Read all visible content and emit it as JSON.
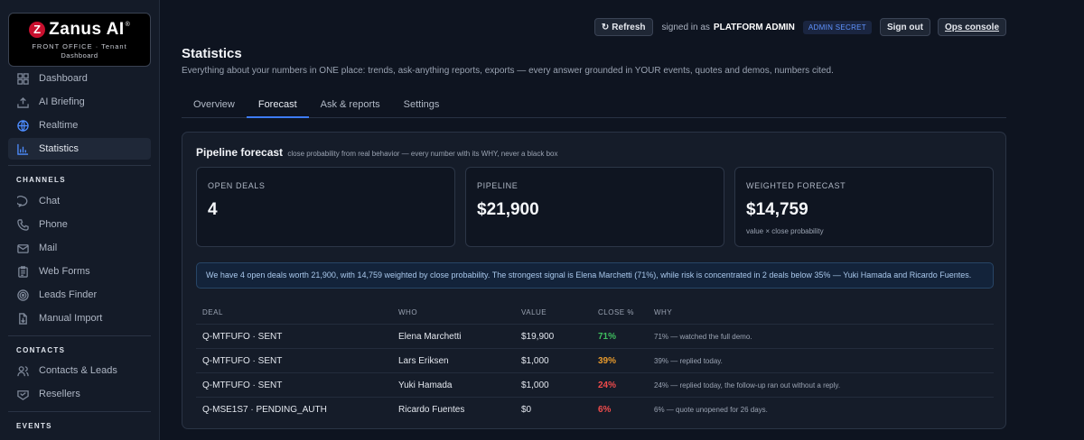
{
  "brand": {
    "logo_letter": "Z",
    "name": "Zanus AI",
    "reg_mark": "®",
    "subtitle": "FRONT OFFICE · Tenant",
    "subtitle2": "Dashboard"
  },
  "sidebar": {
    "main_items": [
      {
        "label": "Dashboard",
        "icon": "grid-icon"
      },
      {
        "label": "AI Briefing",
        "icon": "upload-tray-icon"
      },
      {
        "label": "Realtime",
        "icon": "globe-icon"
      },
      {
        "label": "Statistics",
        "icon": "bar-chart-icon",
        "active": true
      }
    ],
    "channels_label": "CHANNELS",
    "channel_items": [
      {
        "label": "Chat",
        "icon": "chat-bubble-icon"
      },
      {
        "label": "Phone",
        "icon": "phone-icon"
      },
      {
        "label": "Mail",
        "icon": "mail-icon"
      },
      {
        "label": "Web Forms",
        "icon": "clipboard-icon"
      },
      {
        "label": "Leads Finder",
        "icon": "target-icon"
      },
      {
        "label": "Manual Import",
        "icon": "file-import-icon"
      }
    ],
    "contacts_label": "CONTACTS",
    "contact_items": [
      {
        "label": "Contacts & Leads",
        "icon": "users-icon"
      },
      {
        "label": "Resellers",
        "icon": "handshake-icon"
      }
    ],
    "events_label": "EVENTS"
  },
  "topbar": {
    "refresh_icon": "↻",
    "refresh_label": "Refresh",
    "signed_in_text": "signed in as",
    "role": "PLATFORM ADMIN",
    "badge": "ADMIN SECRET",
    "signout_label": "Sign out",
    "ops_label": "Ops console"
  },
  "page": {
    "title": "Statistics",
    "description": "Everything about your numbers in ONE place: trends, ask-anything reports, exports — every answer grounded in YOUR events, quotes and demos, numbers cited."
  },
  "tabs": [
    {
      "label": "Overview"
    },
    {
      "label": "Forecast",
      "active": true
    },
    {
      "label": "Ask & reports"
    },
    {
      "label": "Settings"
    }
  ],
  "forecast": {
    "title": "Pipeline forecast",
    "subtitle": "close probability from real behavior — every number with its WHY, never a black box",
    "kpis": [
      {
        "label": "OPEN DEALS",
        "value": "4",
        "note": ""
      },
      {
        "label": "PIPELINE",
        "value": "$21,900",
        "note": ""
      },
      {
        "label": "WEIGHTED FORECAST",
        "value": "$14,759",
        "note": "value × close probability"
      }
    ],
    "insight": "We have 4 open deals worth 21,900, with 14,759 weighted by close probability. The strongest signal is Elena Marchetti (71%), while risk is concentrated in 2 deals below 35% — Yuki Hamada and Ricardo Fuentes.",
    "table": {
      "headers": [
        "DEAL",
        "WHO",
        "VALUE",
        "CLOSE %",
        "WHY"
      ],
      "rows": [
        {
          "deal": "Q-MTFUFO · SENT",
          "who": "Elena Marchetti",
          "value": "$19,900",
          "close": "71%",
          "close_color": "#3fbf5f",
          "why": "71% — watched the full demo."
        },
        {
          "deal": "Q-MTFUFO · SENT",
          "who": "Lars Eriksen",
          "value": "$1,000",
          "close": "39%",
          "close_color": "#e89a2c",
          "why": "39% — replied today."
        },
        {
          "deal": "Q-MTFUFO · SENT",
          "who": "Yuki Hamada",
          "value": "$1,000",
          "close": "24%",
          "close_color": "#ef4b4b",
          "why": "24% — replied today, the follow-up ran out without a reply."
        },
        {
          "deal": "Q-MSE1S7 · PENDING_AUTH",
          "who": "Ricardo Fuentes",
          "value": "$0",
          "close": "6%",
          "close_color": "#ef4b4b",
          "why": "6% — quote unopened for 26 days."
        }
      ]
    }
  },
  "colors": {
    "accent": "#3d7bf5",
    "background": "#0e1420",
    "panel": "#151c29"
  }
}
